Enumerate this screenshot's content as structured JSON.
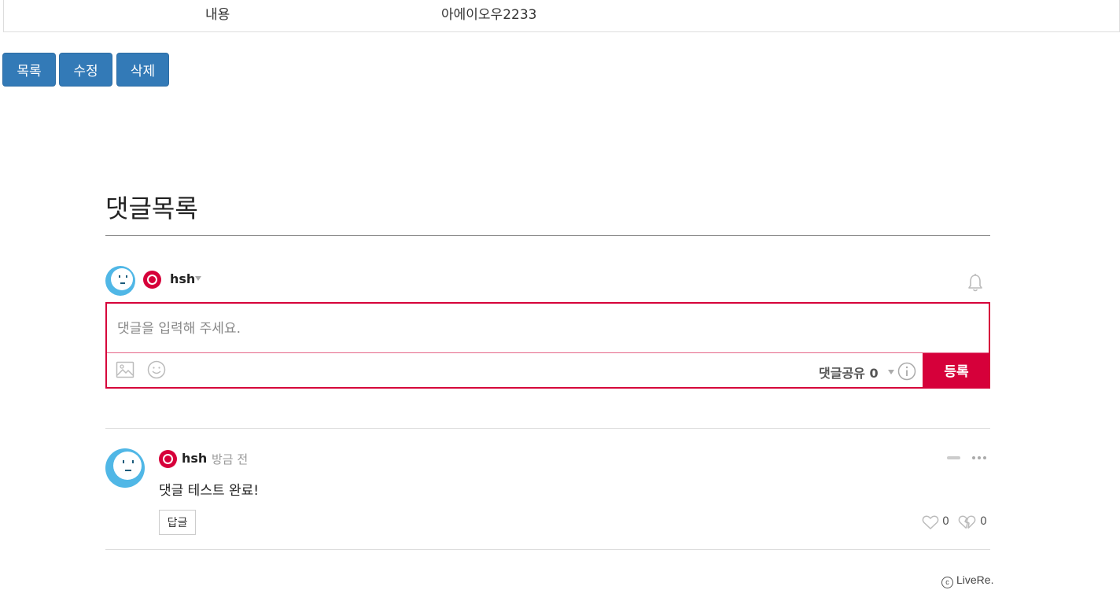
{
  "post": {
    "content_label": "내용",
    "content_value": "아에이오우2233"
  },
  "actions": {
    "list_label": "목록",
    "edit_label": "수정",
    "delete_label": "삭제"
  },
  "comments": {
    "section_title": "댓글목록",
    "current_user": {
      "name": "hsh"
    },
    "editor": {
      "placeholder": "댓글을 입력해 주세요.",
      "share_label": "댓글공유",
      "share_count": "0",
      "submit_label": "등록"
    },
    "items": [
      {
        "author": "hsh",
        "time": "방금 전",
        "text": "댓글 테스트 완료!",
        "reply_label": "답글",
        "likes": "0",
        "dislikes": "0"
      }
    ],
    "brand": "LiveRe."
  },
  "colors": {
    "primary_button": "#337ab7",
    "accent": "#d6003a",
    "avatar": "#50b7e6"
  }
}
